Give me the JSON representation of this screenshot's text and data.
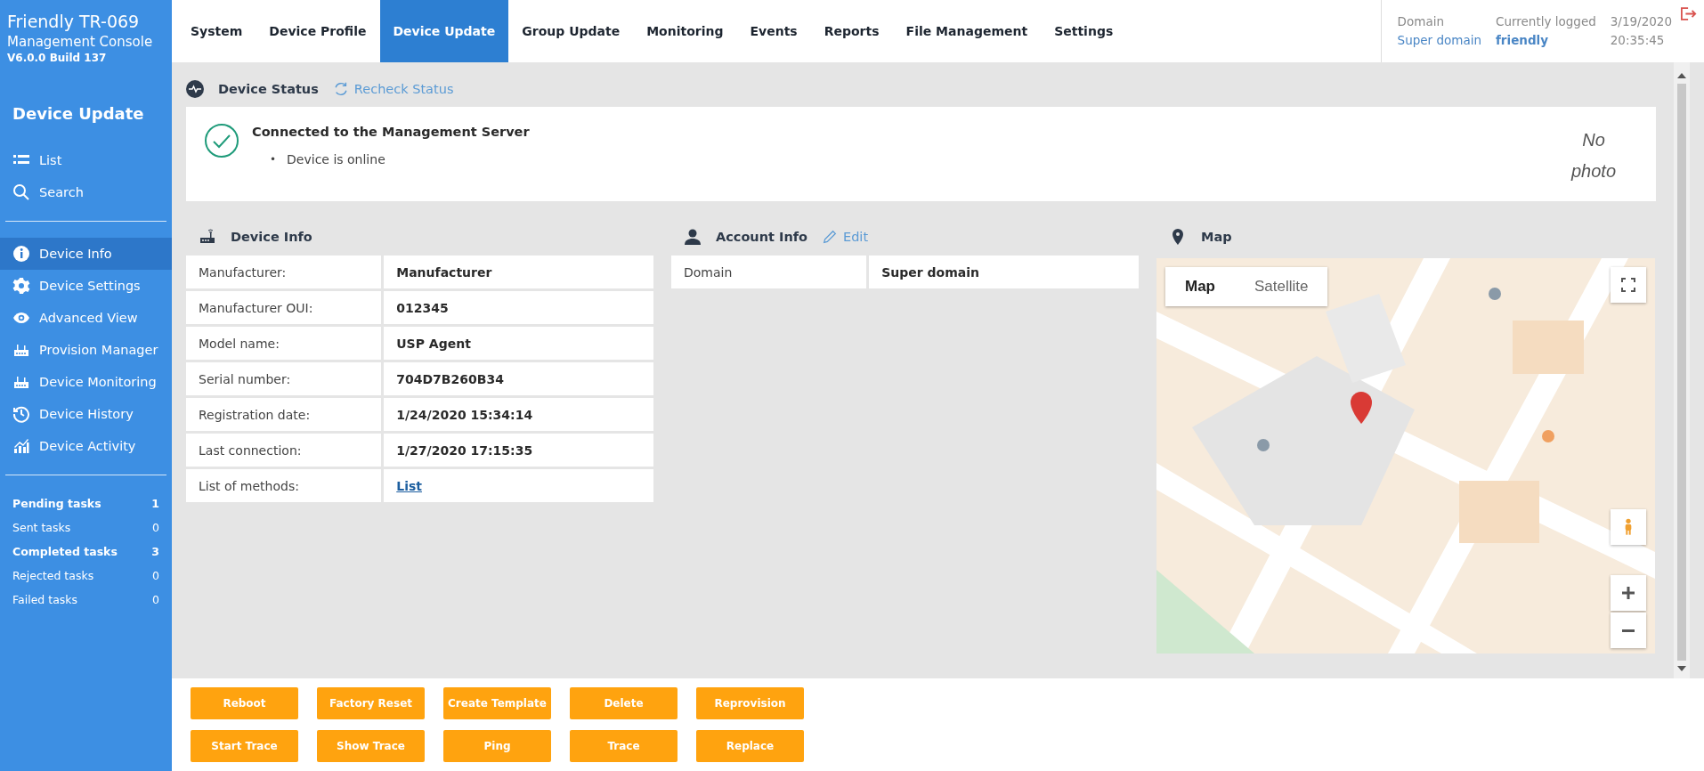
{
  "app": {
    "title": "Friendly TR-069",
    "subtitle": "Management Console",
    "version": "V6.0.0 Build 137"
  },
  "sidebar": {
    "section_title": "Device Update",
    "top_items": [
      {
        "label": "List"
      },
      {
        "label": "Search"
      }
    ],
    "items": [
      {
        "label": "Device Info",
        "selected": true
      },
      {
        "label": "Device Settings",
        "selected": false
      },
      {
        "label": "Advanced View",
        "selected": false
      },
      {
        "label": "Provision Manager",
        "selected": false
      },
      {
        "label": "Device Monitoring",
        "selected": false
      },
      {
        "label": "Device History",
        "selected": false
      },
      {
        "label": "Device Activity",
        "selected": false
      }
    ],
    "tasks": [
      {
        "label": "Pending tasks",
        "count": "1",
        "bold": true
      },
      {
        "label": "Sent tasks",
        "count": "0",
        "bold": false
      },
      {
        "label": "Completed tasks",
        "count": "3",
        "bold": true
      },
      {
        "label": "Rejected tasks",
        "count": "0",
        "bold": false
      },
      {
        "label": "Failed tasks",
        "count": "0",
        "bold": false
      }
    ]
  },
  "tabs": [
    {
      "label": "System",
      "selected": false
    },
    {
      "label": "Device Profile",
      "selected": false
    },
    {
      "label": "Device Update",
      "selected": true
    },
    {
      "label": "Group Update",
      "selected": false
    },
    {
      "label": "Monitoring",
      "selected": false
    },
    {
      "label": "Events",
      "selected": false
    },
    {
      "label": "Reports",
      "selected": false
    },
    {
      "label": "File Management",
      "selected": false
    },
    {
      "label": "Settings",
      "selected": false
    }
  ],
  "header_info": {
    "domain_label": "Domain",
    "domain": "Super domain",
    "user_label": "Currently logged",
    "user": "friendly",
    "date": "3/19/2020",
    "time": "20:35:45"
  },
  "device_status": {
    "title": "Device Status",
    "recheck": "Recheck Status",
    "message": "Connected to the Management Server",
    "details": [
      {
        "bullet": "•",
        "text": "Device is online"
      }
    ],
    "photo": "No photo"
  },
  "device_info": {
    "title": "Device Info",
    "rows": [
      {
        "label": "Manufacturer:",
        "value": "Manufacturer",
        "kind": "text"
      },
      {
        "label": "Manufacturer OUI:",
        "value": "012345",
        "kind": "text"
      },
      {
        "label": "Model name:",
        "value": "USP Agent",
        "kind": "text"
      },
      {
        "label": "Serial number:",
        "value": "704D7B260B34",
        "kind": "text"
      },
      {
        "label": "Registration date:",
        "value": "1/24/2020 15:34:14",
        "kind": "text"
      },
      {
        "label": "Last connection:",
        "value": "1/27/2020 17:15:35",
        "kind": "text"
      },
      {
        "label": "List of methods:",
        "value": "List",
        "kind": "link"
      }
    ]
  },
  "account_info": {
    "title": "Account Info",
    "edit": "Edit",
    "rows": [
      {
        "label": "Domain",
        "value": "Super domain"
      }
    ]
  },
  "map": {
    "title": "Map",
    "kind": "picture",
    "types": [
      {
        "label": "Map",
        "selected": true
      },
      {
        "label": "Satellite",
        "selected": false
      }
    ]
  },
  "actions": [
    [
      "Reboot",
      "Factory Reset",
      "Create Template",
      "Delete",
      "Reprovision"
    ],
    [
      "Start Trace",
      "Show Trace",
      "Ping",
      "Trace",
      "Replace"
    ]
  ]
}
